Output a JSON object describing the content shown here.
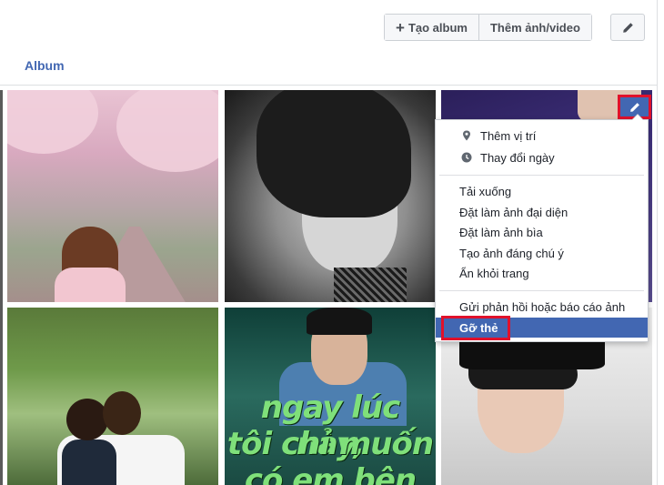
{
  "toolbar": {
    "create_album_label": "Tạo album",
    "add_media_label": "Thêm ảnh/video",
    "plus_icon": "plus-icon",
    "edit_icon": "pencil-icon"
  },
  "tabs": {
    "album_label": "Album"
  },
  "photos": {
    "lyric_line1": "ngay lúc này,",
    "lyric_line2": "tôi chỉ muốn",
    "lyric_line3": "có em bên"
  },
  "photo_menu": {
    "group1": [
      {
        "label": "Thêm vị trí",
        "icon": "location-pin-icon"
      },
      {
        "label": "Thay đổi ngày",
        "icon": "clock-icon"
      }
    ],
    "group2": [
      {
        "label": "Tải xuống"
      },
      {
        "label": "Đặt làm ảnh đại diện"
      },
      {
        "label": "Đặt làm ảnh bìa"
      },
      {
        "label": "Tạo ảnh đáng chú ý"
      },
      {
        "label": "Ẩn khỏi trang"
      }
    ],
    "group3": [
      {
        "label": "Gửi phản hồi hoặc báo cáo ảnh"
      },
      {
        "label": "Gỡ thẻ"
      }
    ]
  },
  "colors": {
    "accent": "#4267b2",
    "highlight_border": "#e0112b",
    "menu_active_bg": "#4267b2"
  }
}
